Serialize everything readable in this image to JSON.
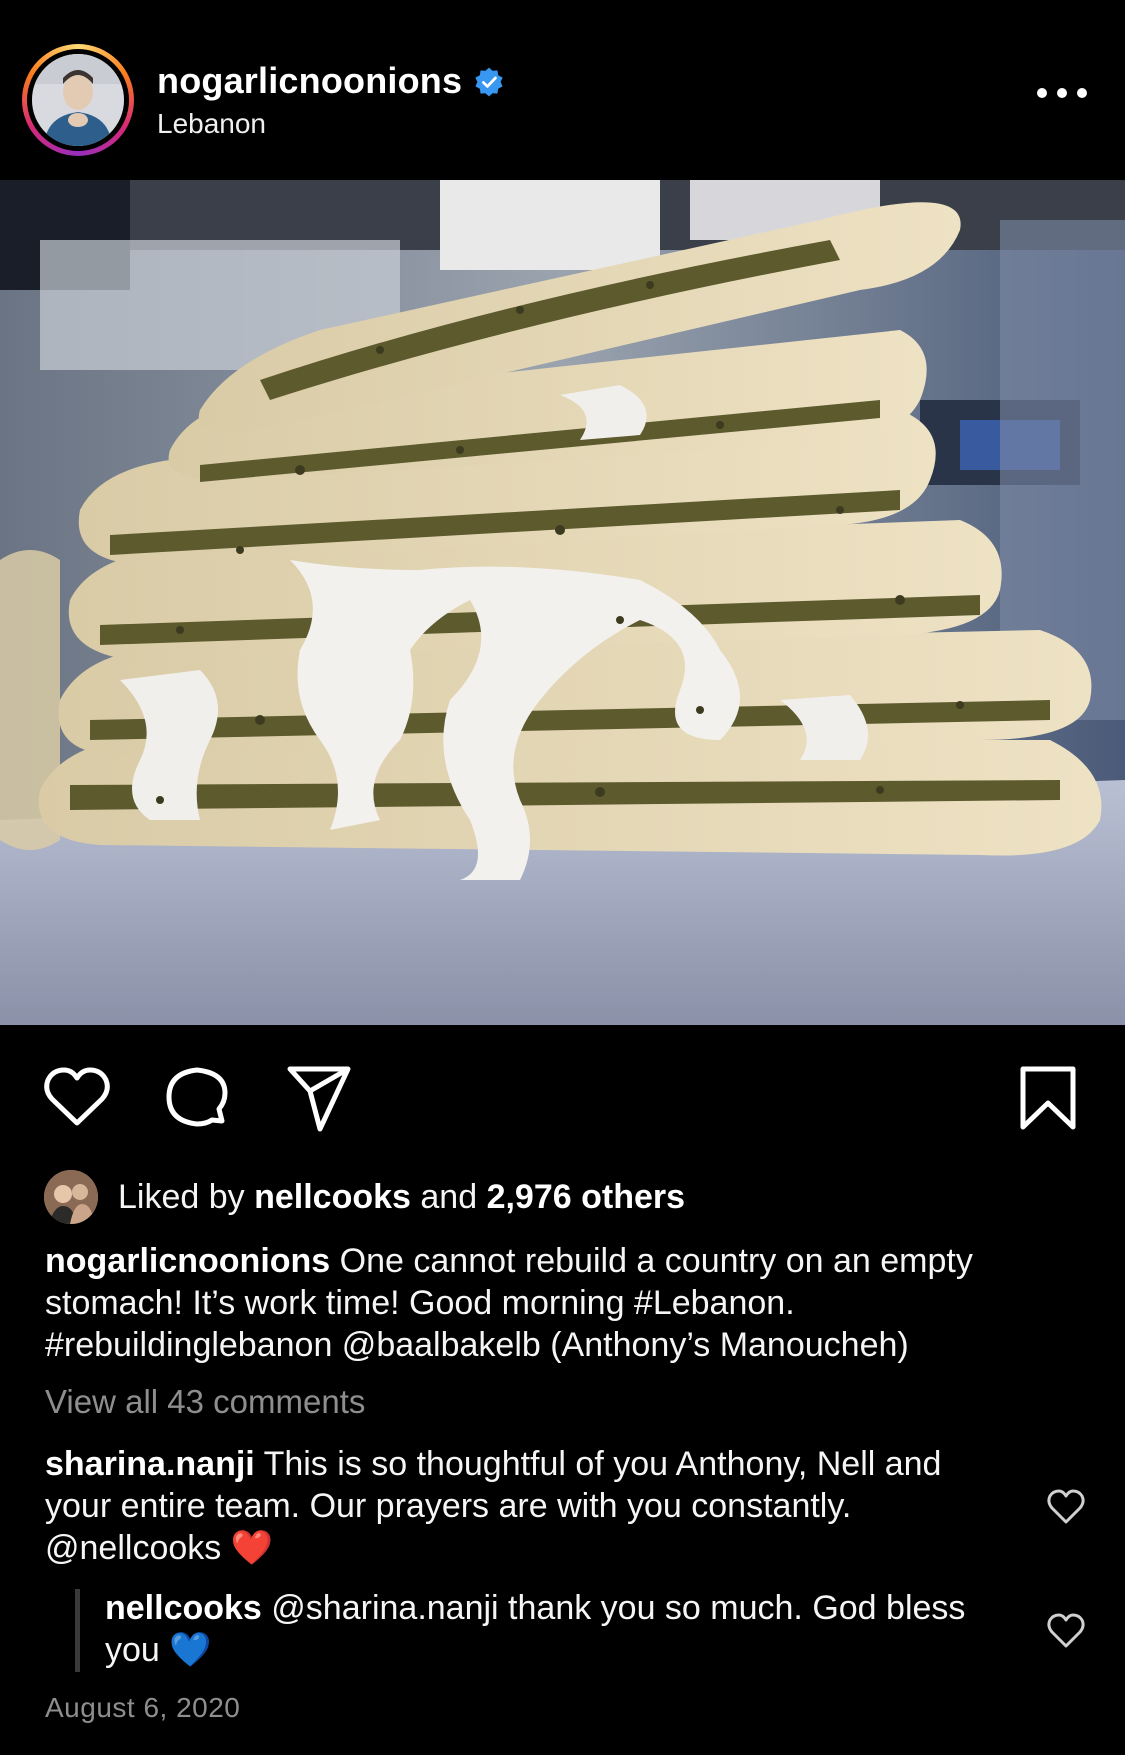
{
  "post": {
    "username": "nogarlicnoonions",
    "location": "Lebanon",
    "verified": true,
    "image_alt": "Stacked manoucheh flatbreads with zaatar and melted cheese"
  },
  "likes": {
    "prefix": "Liked by",
    "liker": "nellcooks",
    "joiner": "and",
    "count_text": "2,976 others"
  },
  "caption": {
    "username": "nogarlicnoonions",
    "text": "One cannot rebuild a country on an empty stomach! It’s work time! Good morning #Lebanon. #rebuildinglebanon @baalbakelb (Anthony’s Manoucheh)"
  },
  "comments_link": "View all 43 comments",
  "comments": [
    {
      "username": "sharina.nanji",
      "text": "This is so thoughtful of you Anthony, Nell and your entire team. Our prayers are with you constantly. @nellcooks",
      "emoji": "❤️"
    }
  ],
  "reply": {
    "username": "nellcooks",
    "text": "@sharina.nanji thank you so much. God bless you",
    "emoji": "💙"
  },
  "date": "August 6, 2020",
  "colors": {
    "background": "#000000",
    "verified": "#3897f0",
    "secondary_text": "#8e8e8e"
  },
  "icons": [
    "more-icon",
    "heart-icon",
    "comment-icon",
    "share-icon",
    "bookmark-icon",
    "verified-icon"
  ]
}
